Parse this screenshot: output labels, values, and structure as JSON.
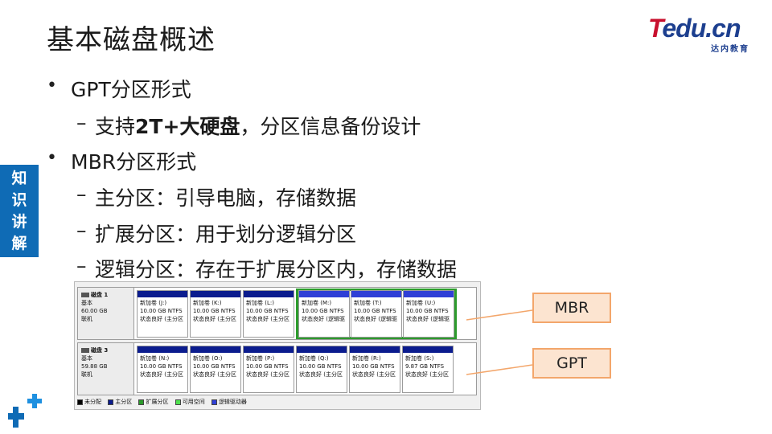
{
  "slide": {
    "title": "基本磁盘概述",
    "side_tag": [
      "知",
      "识",
      "讲",
      "解"
    ]
  },
  "logo": {
    "main_t": "T",
    "main_rest": "edu.cn",
    "sub": "达内教育"
  },
  "bullets": {
    "gpt_heading": "GPT分区形式",
    "gpt_sub_prefix": "支持",
    "gpt_sub_bold": "2T+大硬盘",
    "gpt_sub_suffix": "，分区信息备份设计",
    "mbr_heading": "MBR分区形式",
    "mbr_primary": "主分区：引导电脑，存储数据",
    "mbr_extended": "扩展分区：用于划分逻辑分区",
    "mbr_logical": "逻辑分区：存在于扩展分区内，存储数据",
    "dash": "–",
    "dot": "•"
  },
  "disks": [
    {
      "name": "磁盘 1",
      "type": "基本",
      "size": "60.00 GB",
      "status": "联机",
      "partitions": [
        {
          "label": "新加卷  (J:)",
          "size": "10.00 GB NTFS",
          "state": "状态良好 (主分区"
        },
        {
          "label": "新加卷  (K:)",
          "size": "10.00 GB NTFS",
          "state": "状态良好 (主分区"
        },
        {
          "label": "新加卷  (L:)",
          "size": "10.00 GB NTFS",
          "state": "状态良好 (主分区"
        },
        {
          "label": "新加卷  (M:)",
          "size": "10.00 GB NTFS",
          "state": "状态良好 (逻辑驱"
        },
        {
          "label": "新加卷  (T:)",
          "size": "10.00 GB NTFS",
          "state": "状态良好 (逻辑驱"
        },
        {
          "label": "新加卷  (U:)",
          "size": "10.00 GB NTFS",
          "state": "状态良好 (逻辑驱"
        }
      ]
    },
    {
      "name": "磁盘 3",
      "type": "基本",
      "size": "59.88 GB",
      "status": "联机",
      "partitions": [
        {
          "label": "新加卷  (N:)",
          "size": "10.00 GB NTFS",
          "state": "状态良好 (主分区"
        },
        {
          "label": "新加卷  (O:)",
          "size": "10.00 GB NTFS",
          "state": "状态良好 (主分区"
        },
        {
          "label": "新加卷  (P:)",
          "size": "10.00 GB NTFS",
          "state": "状态良好 (主分区"
        },
        {
          "label": "新加卷  (Q:)",
          "size": "10.00 GB NTFS",
          "state": "状态良好 (主分区"
        },
        {
          "label": "新加卷  (R:)",
          "size": "10.00 GB NTFS",
          "state": "状态良好 (主分区"
        },
        {
          "label": "新加卷  (S:)",
          "size": "9.87 GB NTFS",
          "state": "状态良好 (主分区"
        }
      ]
    }
  ],
  "legend": [
    {
      "label": "未分配",
      "color": "#000000"
    },
    {
      "label": "主分区",
      "color": "#0b1c8e"
    },
    {
      "label": "扩展分区",
      "color": "#2c9b2c"
    },
    {
      "label": "可用空间",
      "color": "#4ee04e"
    },
    {
      "label": "逻辑驱动器",
      "color": "#2f3fd6"
    }
  ],
  "callouts": {
    "mbr": "MBR",
    "gpt": "GPT"
  },
  "colors": {
    "accent_blue": "#0f6bb5",
    "logo_red": "#c8102e",
    "logo_blue": "#1d3f8f",
    "callout_fill": "#fce4d0",
    "callout_border": "#f3a66b"
  }
}
